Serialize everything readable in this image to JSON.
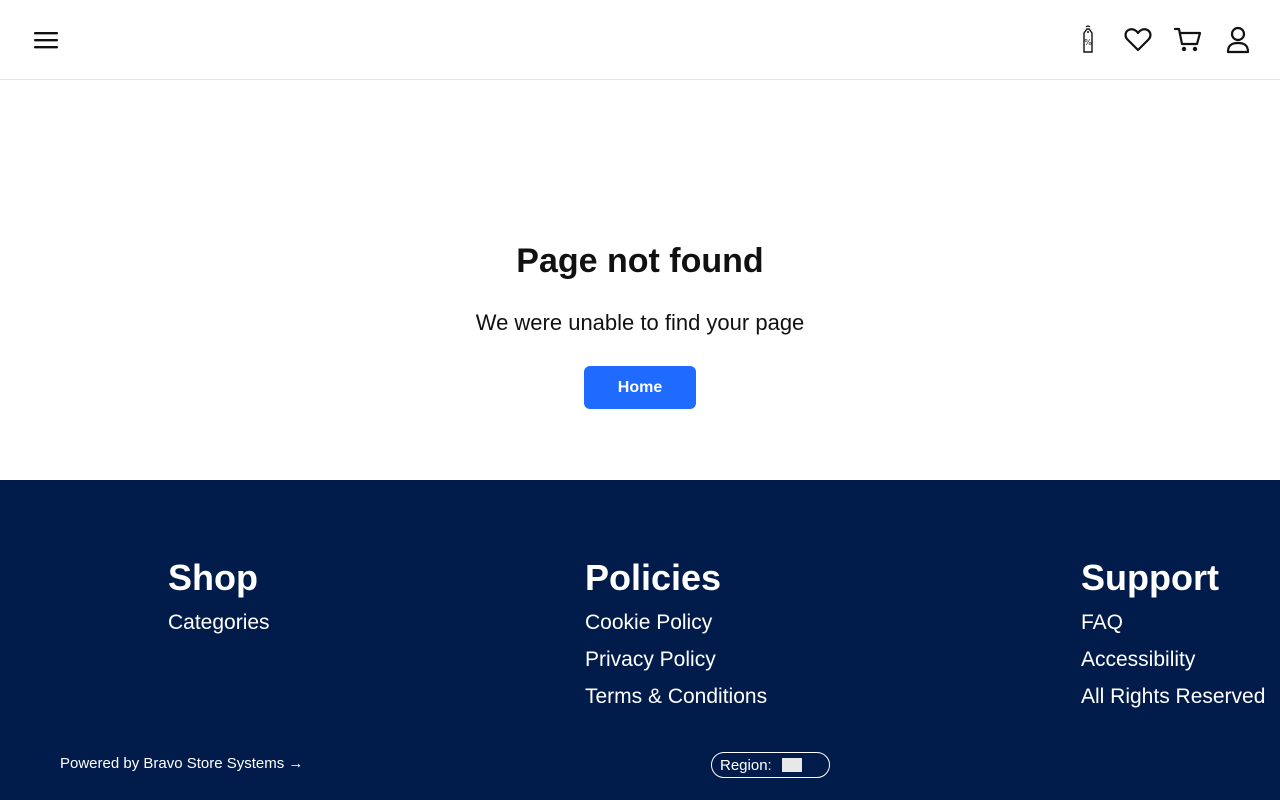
{
  "header": {
    "menu_icon": "hamburger-menu-icon",
    "icons": [
      "price-tag-icon",
      "heart-icon",
      "cart-icon",
      "user-icon"
    ]
  },
  "main": {
    "title": "Page not found",
    "subtitle": "We were unable to find your page",
    "home_button": "Home"
  },
  "footer": {
    "columns": [
      {
        "title": "Shop",
        "links": [
          "Categories"
        ]
      },
      {
        "title": "Policies",
        "links": [
          "Cookie Policy",
          "Privacy Policy",
          "Terms & Conditions"
        ]
      },
      {
        "title": "Support",
        "links": [
          "FAQ",
          "Accessibility",
          "All Rights Reserved"
        ]
      }
    ],
    "powered_by": "Powered by Bravo Store Systems →",
    "region_label": "Region:"
  },
  "colors": {
    "accent": "#1f6bff",
    "footer_bg": "#011b4a"
  }
}
